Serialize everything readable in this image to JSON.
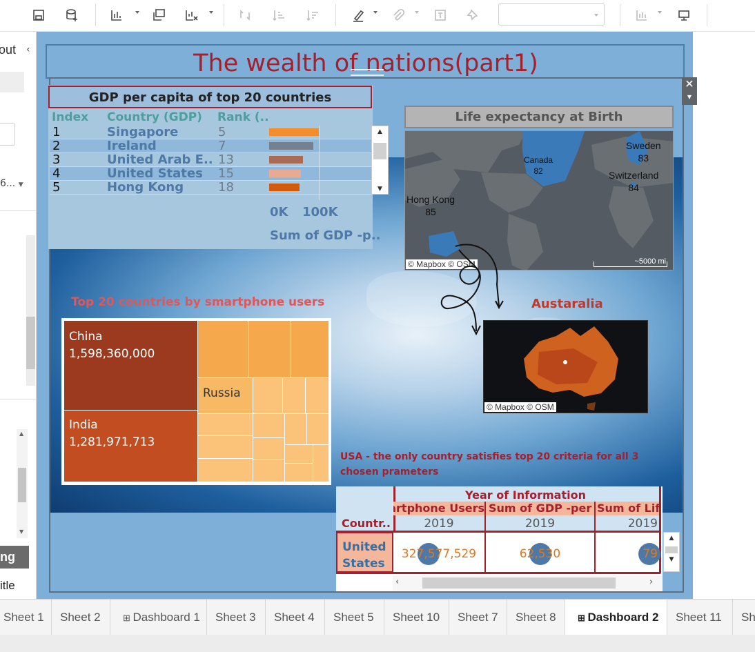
{
  "toolbar": {
    "icons": [
      "save-icon",
      "new-datasource-icon",
      "new-worksheet-icon",
      "duplicate-icon",
      "clear-sheet-icon",
      "swap-icon",
      "sort-ascending-icon",
      "sort-descending-icon",
      "highlight-icon",
      "attach-icon",
      "text-label-icon",
      "pin-icon",
      "show-me-icon",
      "presentation-icon"
    ]
  },
  "left_panel": {
    "title_partial": "out",
    "dropdown_partial": "6...",
    "button_partial": "ng",
    "title_label_partial": "itle"
  },
  "dashboard": {
    "title": "The wealth of nations(part1)",
    "gdp": {
      "title": "GDP per capita of top 20 countries",
      "headers": [
        "Index",
        "Country (GDP)",
        "Rank (.."
      ],
      "rows": [
        {
          "index": "1",
          "country": "Singapore",
          "rank": "5",
          "value": 0.55,
          "color": "#f28e2b"
        },
        {
          "index": "2",
          "country": "Ireland",
          "rank": "7",
          "value": 0.49,
          "color": "#76818f"
        },
        {
          "index": "3",
          "country": "United Arab E..",
          "rank": "13",
          "value": 0.38,
          "color": "#a96b55"
        },
        {
          "index": "4",
          "country": "United States",
          "rank": "15",
          "value": 0.35,
          "color": "#e8ab92"
        },
        {
          "index": "5",
          "country": "Hong Kong",
          "rank": "18",
          "value": 0.34,
          "color": "#d25a0c"
        }
      ],
      "axis_ticks": [
        "0K",
        "100K"
      ],
      "axis_label": "Sum of GDP -p.."
    },
    "life": {
      "title": "Life expectancy at Birth",
      "points": [
        {
          "name": "Canada",
          "value": "82"
        },
        {
          "name": "Sweden",
          "value": "83"
        },
        {
          "name": "Switzerland",
          "value": "84"
        },
        {
          "name": "Hong Kong",
          "value": "85"
        }
      ],
      "attribution": "© Mapbox © OSM",
      "scale": "~5000 mi"
    },
    "smartphone": {
      "title": "Top 20 countries by smartphone users",
      "labels": [
        {
          "name": "China",
          "value": "1,598,360,000"
        },
        {
          "name": "India",
          "value": "1,281,971,713"
        },
        {
          "name": "Russia",
          "value": ""
        }
      ]
    },
    "australia": {
      "title": "Austaralia",
      "attribution": "© Mapbox © OSM"
    },
    "usa_note": "USA -  the only country satisfies top 20 criteria for all 3 chosen prameters",
    "crosstab": {
      "header": "Year of Information",
      "col_headers": [
        "artphone Users",
        "Sum of GDP -per ..",
        "Sum of Life"
      ],
      "years": [
        "2019",
        "2019",
        "2019"
      ],
      "row_header": "Countr..",
      "row_label": "United States",
      "values": [
        "327,577,529",
        "62,530",
        "79"
      ]
    }
  },
  "tabs": [
    "Sheet 1",
    "Sheet 2",
    "Dashboard 1",
    "Sheet 3",
    "Sheet 4",
    "Sheet 5",
    "Sheet 10",
    "Sheet 7",
    "Sheet 8",
    "Dashboard 2",
    "Sheet 11",
    "Sh"
  ],
  "active_tab": "Dashboard 2",
  "colors": {
    "title": "#a4202d",
    "teal": "#4f9e9e",
    "blue_text": "#4e79a7"
  }
}
